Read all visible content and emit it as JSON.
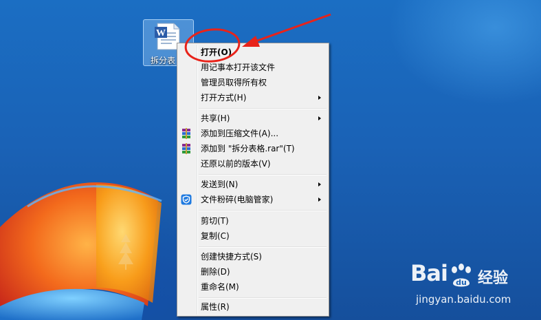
{
  "desktop_icon": {
    "label": "拆分表"
  },
  "context_menu": {
    "items": [
      {
        "label": "打开(O)",
        "bold": true
      },
      {
        "label": "用记事本打开该文件"
      },
      {
        "label": "管理员取得所有权"
      },
      {
        "label": "打开方式(H)",
        "submenu": true
      },
      {
        "label": "共享(H)",
        "submenu": true
      },
      {
        "label": "添加到压缩文件(A)...",
        "icon": "winrar-icon"
      },
      {
        "label": "添加到 \"拆分表格.rar\"(T)",
        "icon": "winrar-icon"
      },
      {
        "label": "还原以前的版本(V)"
      },
      {
        "label": "发送到(N)",
        "submenu": true
      },
      {
        "label": "文件粉碎(电脑管家)",
        "submenu": true,
        "icon": "tencent-guard-icon"
      },
      {
        "label": "剪切(T)"
      },
      {
        "label": "复制(C)"
      },
      {
        "label": "创建快捷方式(S)"
      },
      {
        "label": "删除(D)"
      },
      {
        "label": "重命名(M)"
      },
      {
        "label": "属性(R)"
      }
    ]
  },
  "watermark": {
    "logo_left": "Bai",
    "logo_right": "经验",
    "url": "jingyan.baidu.com"
  },
  "colors": {
    "annotation": "#e8231a",
    "desktop": "#1a62b6",
    "menu_bg": "#f0f0f0"
  }
}
